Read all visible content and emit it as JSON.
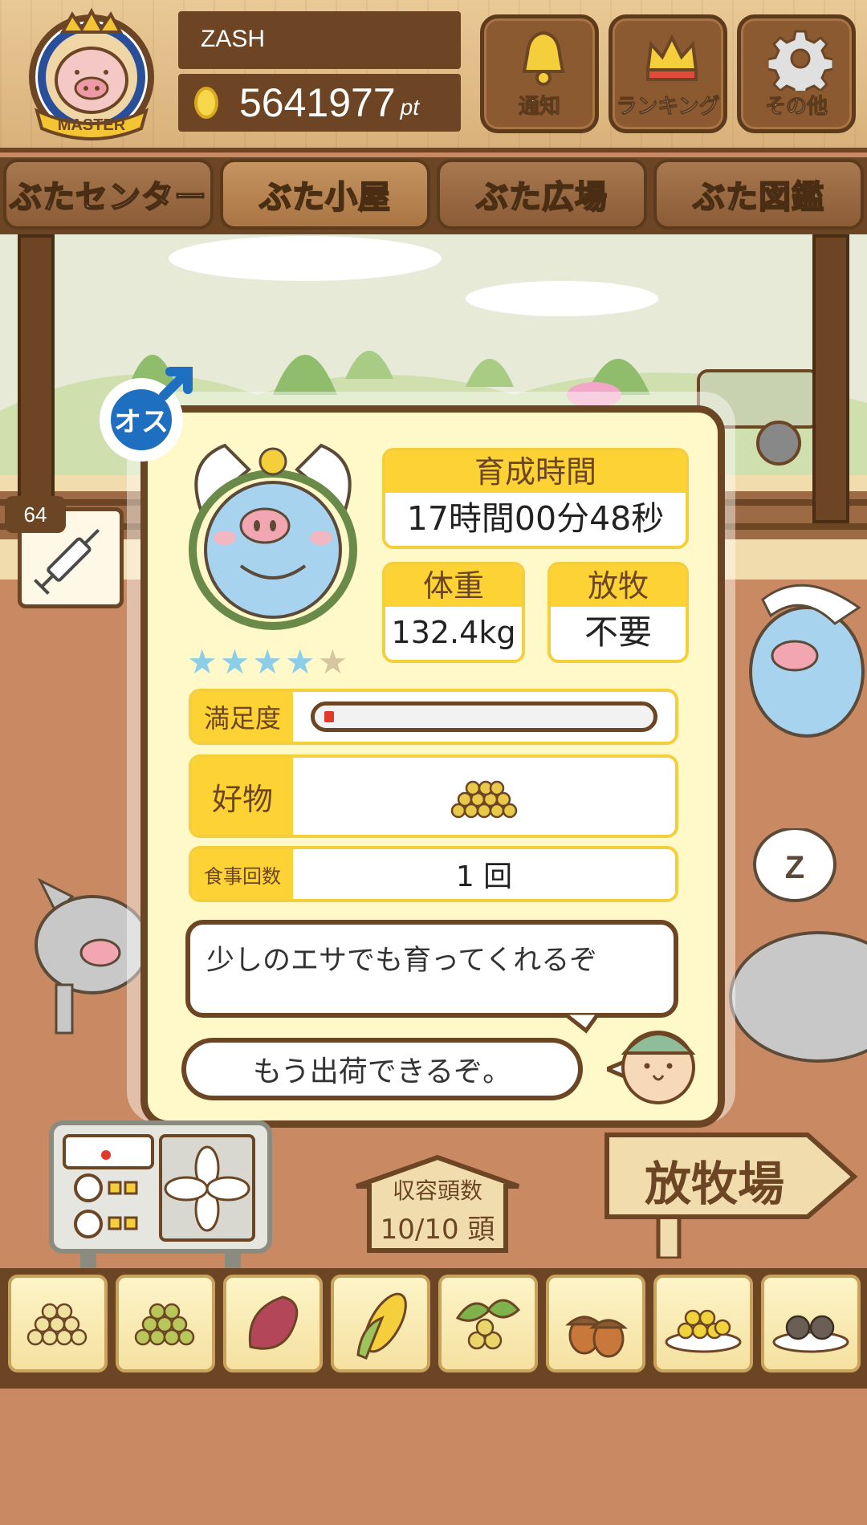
{
  "player": {
    "name": "ZASH",
    "rank_badge": "MASTER",
    "points": "5641977",
    "points_unit": "pt"
  },
  "top_buttons": [
    {
      "label": "通知",
      "icon": "bell-icon"
    },
    {
      "label": "ランキング",
      "icon": "crown-icon"
    },
    {
      "label": "その他",
      "icon": "gear-icon"
    }
  ],
  "tabs": [
    {
      "label": "ぶたセンター",
      "active": false
    },
    {
      "label": "ぶた小屋",
      "active": true
    },
    {
      "label": "ぶた広場",
      "active": false
    },
    {
      "label": "ぶた図鑑",
      "active": false
    }
  ],
  "injection_count": "64",
  "pig": {
    "sex_label": "オス",
    "stars_filled": 4,
    "stars_total": 5,
    "raise_time_label": "育成時間",
    "raise_time": "17時間00分48秒",
    "weight_label": "体重",
    "weight": "132.4kg",
    "graze_label": "放牧",
    "graze": "不要",
    "satisfaction_label": "満足度",
    "satisfaction": 0.03,
    "favorite_label": "好物",
    "favorite_food_icon": "grain-pile-icon",
    "meals_label": "食事回数",
    "meals": "1 回",
    "comment": "少しのエサでも育ってくれるぞ",
    "farmer_says": "もう出荷できるぞ。"
  },
  "facility": {
    "capacity_label": "収容頭数",
    "capacity": "10/10 頭",
    "pasture_sign": "放牧場"
  },
  "food_items": [
    "grain-pile-icon",
    "green-grain-icon",
    "sweet-potato-icon",
    "corn-icon",
    "leaf-beans-icon",
    "acorn-icon",
    "grain-plate-icon",
    "dark-balls-plate-icon"
  ],
  "colors": {
    "wood_dark": "#6b4524",
    "accent_yellow": "#fcd234",
    "tab_active_text": "#f7d13a",
    "card_bg": "#fff9c9",
    "male_blue": "#1f6fc1"
  }
}
